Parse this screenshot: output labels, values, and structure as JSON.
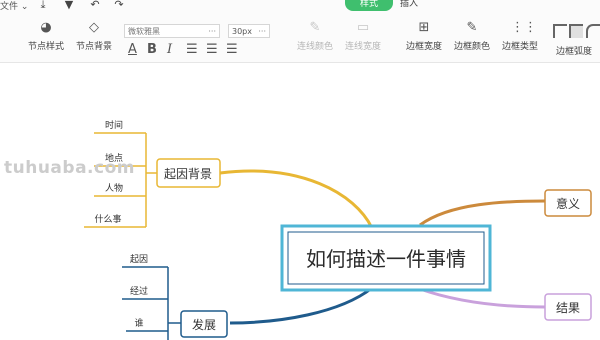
{
  "menu": {
    "file": "文件"
  },
  "tabs": {
    "style": "样式",
    "insert": "插入"
  },
  "toolbar": {
    "node_style": "节点样式",
    "node_background": "节点背景",
    "font_family": "微软雅黑",
    "font_size": "30px",
    "line_color": "连线颜色",
    "line_width": "连线宽度",
    "border_width": "边框宽度",
    "border_color": "边框颜色",
    "border_type": "边框类型",
    "border_radius": "边框弧度"
  },
  "mindmap": {
    "root": "如何描述一件事情",
    "branches": {
      "background": {
        "label": "起因背景",
        "children": [
          "时间",
          "地点",
          "人物",
          "什么事"
        ]
      },
      "meaning": {
        "label": "意义"
      },
      "result": {
        "label": "结果"
      },
      "development": {
        "label": "发展",
        "children": [
          "起因",
          "经过",
          "谁"
        ]
      }
    }
  },
  "colors": {
    "background_branch": "#e8b734",
    "meaning_branch": "#cc8a3c",
    "result_branch": "#c9a1dc",
    "development_branch": "#1f5b8c",
    "root_border": "#4fb6d6",
    "active_tab": "#3fbf6e"
  },
  "watermark": "tuhuaba.com"
}
